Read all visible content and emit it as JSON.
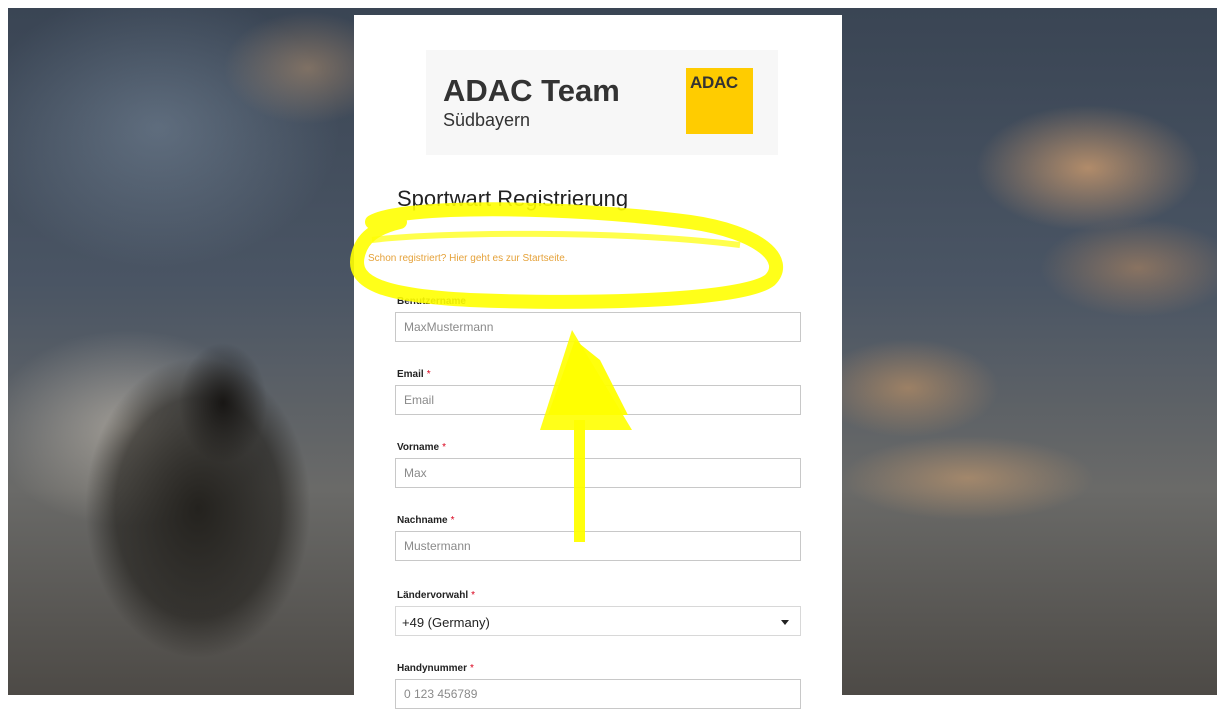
{
  "logo": {
    "title": "ADAC Team",
    "subtitle": "Südbayern",
    "badge": "ADAC",
    "badge_color": "#ffcc00"
  },
  "page": {
    "title": "Sportwart Registrierung",
    "signin_link": "Schon registriert? Hier geht es zur Startseite."
  },
  "fields": {
    "username": {
      "label": "Benutzername",
      "placeholder": "MaxMustermann",
      "required": false
    },
    "email": {
      "label": "Email",
      "placeholder": "Email",
      "required": true
    },
    "firstname": {
      "label": "Vorname",
      "placeholder": "Max",
      "required": true
    },
    "lastname": {
      "label": "Nachname",
      "placeholder": "Mustermann",
      "required": true
    },
    "country_code": {
      "label": "Ländervorwahl",
      "value": "+49 (Germany)",
      "required": true
    },
    "phone": {
      "label": "Handynummer",
      "placeholder": "0 123 456789",
      "required": true
    }
  },
  "required_marker": "*",
  "colors": {
    "link": "#e5a23a",
    "required": "#d9001b",
    "highlight": "#ffff00"
  }
}
